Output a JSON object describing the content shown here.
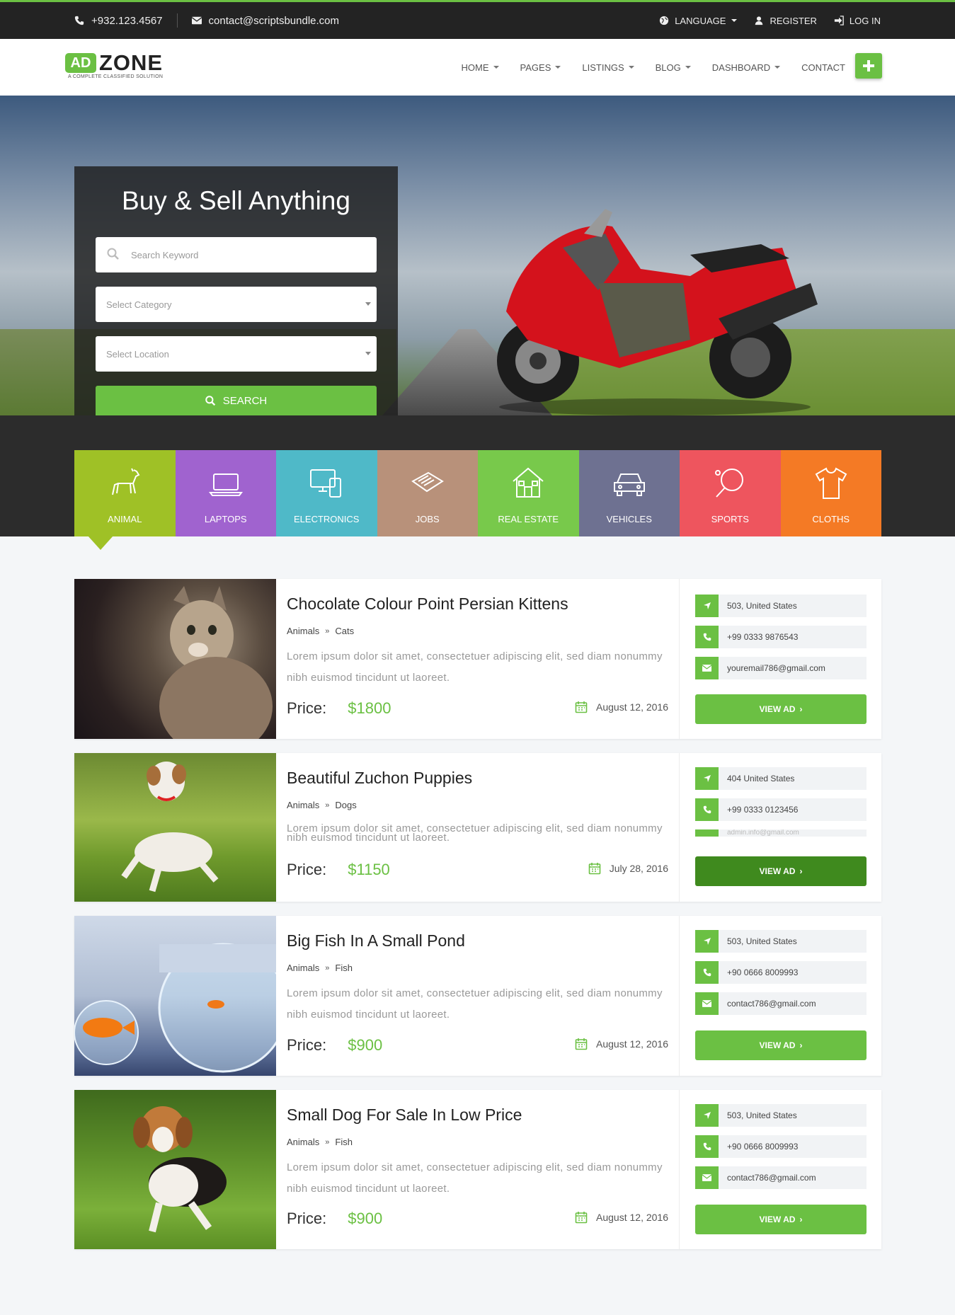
{
  "topbar": {
    "phone": "+932.123.4567",
    "email": "contact@scriptsbundle.com",
    "language": "LANGUAGE",
    "register": "REGISTER",
    "login": "LOG IN"
  },
  "logo": {
    "ad": "AD",
    "zone": "ZONE",
    "tagline": "A COMPLETE CLASSIFIED SOLUTION"
  },
  "nav": {
    "home": "HOME",
    "pages": "PAGES",
    "listings": "LISTINGS",
    "blog": "BLOG",
    "dashboard": "DASHBOARD",
    "contact": "CONTACT"
  },
  "hero": {
    "title": "Buy & Sell Anything",
    "keyword_placeholder": "Search Keyword",
    "category_placeholder": "Select Category",
    "location_placeholder": "Select Location",
    "search_label": "SEARCH"
  },
  "categories": [
    {
      "label": "ANIMAL",
      "color": "#9fc126",
      "icon": "dog-icon"
    },
    {
      "label": "LAPTOPS",
      "color": "#a063cf",
      "icon": "laptop-icon"
    },
    {
      "label": "ELECTRONICS",
      "color": "#4fb9c8",
      "icon": "devices-icon"
    },
    {
      "label": "JOBS",
      "color": "#b8917a",
      "icon": "newspaper-icon"
    },
    {
      "label": "REAL ESTATE",
      "color": "#78c94b",
      "icon": "house-icon"
    },
    {
      "label": "VEHICLES",
      "color": "#6e7191",
      "icon": "car-icon"
    },
    {
      "label": "SPORTS",
      "color": "#ee555e",
      "icon": "ping-pong-icon"
    },
    {
      "label": "CLOTHS",
      "color": "#f47a25",
      "icon": "shirt-icon"
    }
  ],
  "listings": [
    {
      "title": "Chocolate Colour Point Persian Kittens",
      "cat": "Animals",
      "sub": "Cats",
      "desc": "Lorem ipsum dolor sit amet, consectetuer adipiscing elit, sed diam nonummy nibh euismod tincidunt ut laoreet.",
      "price_label": "Price:",
      "price": "$1800",
      "date": "August 12, 2016",
      "location": "503, United States",
      "phone": "+99 0333 9876543",
      "email": "youremail786@gmail.com",
      "btn": "VIEW AD"
    },
    {
      "title": "Beautiful Zuchon Puppies",
      "cat": "Animals",
      "sub": "Dogs",
      "desc": "Lorem ipsum dolor sit amet, consectetuer adipiscing elit, sed diam nonummy nibh euismod tincidunt ut laoreet.",
      "price_label": "Price:",
      "price": "$1150",
      "date": "July 28, 2016",
      "location": "404 United States",
      "phone": "+99 0333 0123456",
      "email": "admin.info@gmail.com",
      "btn": "VIEW AD"
    },
    {
      "title": "Big Fish In A Small Pond",
      "cat": "Animals",
      "sub": "Fish",
      "desc": "Lorem ipsum dolor sit amet, consectetuer adipiscing elit, sed diam nonummy nibh euismod tincidunt ut laoreet.",
      "price_label": "Price:",
      "price": "$900",
      "date": "August 12, 2016",
      "location": "503, United States",
      "phone": "+90 0666 8009993",
      "email": "contact786@gmail.com",
      "btn": "VIEW AD"
    },
    {
      "title": "Small Dog For Sale In Low Price",
      "cat": "Animals",
      "sub": "Fish",
      "desc": "Lorem ipsum dolor sit amet, consectetuer adipiscing elit, sed diam nonummy nibh euismod tincidunt ut laoreet.",
      "price_label": "Price:",
      "price": "$900",
      "date": "August 12, 2016",
      "location": "503, United States",
      "phone": "+90 0666 8009993",
      "email": "contact786@gmail.com",
      "btn": "VIEW AD"
    }
  ],
  "colors": {
    "accent": "#6bc043",
    "accent_dark": "#3f8a1e",
    "topbar": "#232323"
  }
}
